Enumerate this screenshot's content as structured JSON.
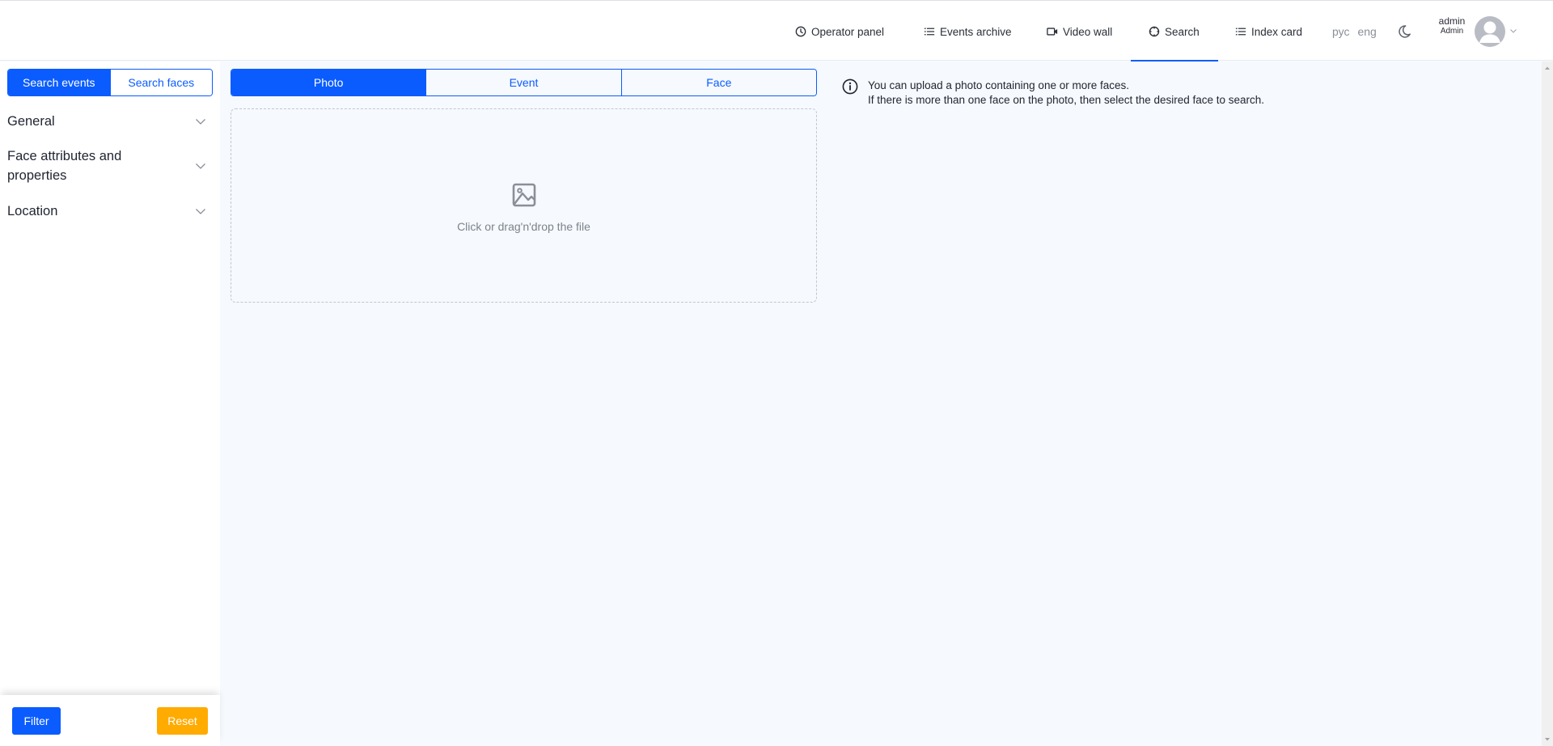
{
  "header": {
    "nav": [
      {
        "label": "Operator panel",
        "icon": "clock-icon"
      },
      {
        "label": "Events archive",
        "icon": "list-icon"
      },
      {
        "label": "Video wall",
        "icon": "video-camera-icon"
      },
      {
        "label": "Search",
        "icon": "search-target-icon",
        "active": true
      },
      {
        "label": "Index card",
        "icon": "list-icon"
      }
    ],
    "languages": [
      "рус",
      "eng"
    ],
    "theme_toggle_icon": "moon-icon",
    "user": {
      "name": "admin",
      "role": "Admin"
    }
  },
  "sidebar": {
    "mode_tabs": [
      {
        "label": "Search events",
        "active": true
      },
      {
        "label": "Search faces",
        "active": false
      }
    ],
    "sections": [
      {
        "label": "General"
      },
      {
        "label": "Face attributes and properties"
      },
      {
        "label": "Location"
      }
    ],
    "footer": {
      "filter_label": "Filter",
      "reset_label": "Reset"
    }
  },
  "main": {
    "source_tabs": [
      {
        "label": "Photo",
        "active": true
      },
      {
        "label": "Event",
        "active": false
      },
      {
        "label": "Face",
        "active": false
      }
    ],
    "dropzone": {
      "text": "Click or drag'n'drop the file",
      "icon": "image-icon"
    },
    "info": {
      "line1": "You can upload a photo containing one or more faces.",
      "line2": "If there is more than one face on the photo, then select the desired face to search."
    }
  },
  "colors": {
    "primary": "#0a5cff",
    "warning": "#ffab00",
    "background": "#f6f9fd"
  }
}
